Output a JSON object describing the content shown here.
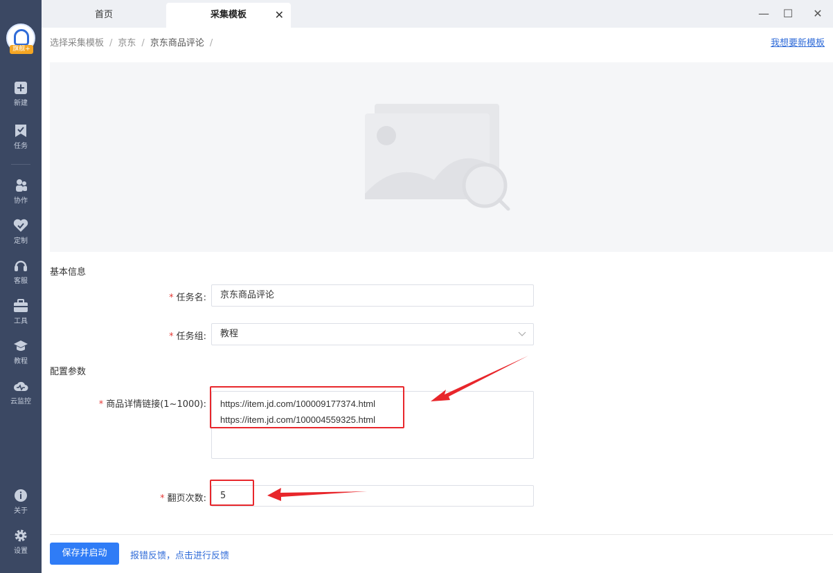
{
  "sidebar": {
    "badge": "旗舰+",
    "items": [
      {
        "label": "新建",
        "icon": "plus-square-icon"
      },
      {
        "label": "任务",
        "icon": "task-flag-icon"
      },
      {
        "label": "协作",
        "icon": "people-icon"
      },
      {
        "label": "定制",
        "icon": "heart-check-icon"
      },
      {
        "label": "客服",
        "icon": "headset-icon"
      },
      {
        "label": "工具",
        "icon": "toolbox-icon"
      },
      {
        "label": "教程",
        "icon": "graduation-cap-icon"
      },
      {
        "label": "云监控",
        "icon": "cloud-monitor-icon"
      },
      {
        "label": "关于",
        "icon": "info-icon"
      },
      {
        "label": "设置",
        "icon": "gear-icon"
      }
    ]
  },
  "tabs": {
    "home": "首页",
    "active": "采集模板",
    "close": "✕"
  },
  "window": {
    "minimize": "—",
    "maximize": "☐",
    "close": "✕"
  },
  "breadcrumb": [
    "选择采集模板",
    "京东",
    "京东商品评论"
  ],
  "breadcrumb_sep": "/",
  "request_link": "我想要新模板",
  "form": {
    "basic_title": "基本信息",
    "task_name_label": "任务名:",
    "task_name_value": "京东商品评论",
    "task_group_label": "任务组:",
    "task_group_value": "教程",
    "config_title": "配置参数",
    "urls_label": "商品详情链接(1~1000):",
    "urls": [
      "https://item.jd.com/100009177374.html",
      "https://item.jd.com/100004559325.html"
    ],
    "pages_label": "翻页次数:",
    "pages_value": "5",
    "required_mark": "*"
  },
  "footer": {
    "save_label": "保存并启动",
    "feedback_label": "报错反馈，点击进行反馈"
  },
  "colors": {
    "sidebar": "#3b4863",
    "accent": "#2f7cf6",
    "annotation": "#e8262b",
    "required": "#e53935"
  }
}
